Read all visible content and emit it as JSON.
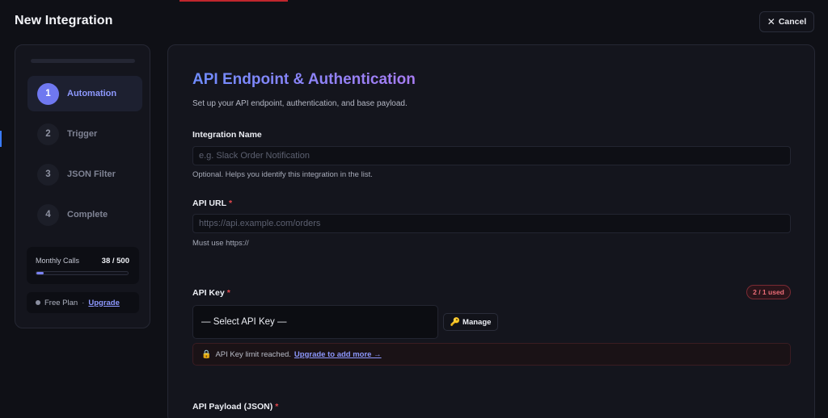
{
  "header": {
    "title": "New Integration",
    "cancel_label": "Cancel"
  },
  "steps": [
    {
      "number": "1",
      "label": "Automation",
      "active": true
    },
    {
      "number": "2",
      "label": "Trigger",
      "active": false
    },
    {
      "number": "3",
      "label": "JSON Filter",
      "active": false
    },
    {
      "number": "4",
      "label": "Complete",
      "active": false
    }
  ],
  "usage": {
    "label": "Monthly Calls",
    "count": "38 / 500",
    "progress_fraction": 0.076
  },
  "plan": {
    "name": "Free Plan",
    "separator": "·",
    "upgrade_label": "Upgrade"
  },
  "main": {
    "title": "API Endpoint & Authentication",
    "subtitle": "Set up your API endpoint, authentication, and base payload.",
    "integration_name": {
      "label": "Integration Name",
      "placeholder": "e.g. Slack Order Notification",
      "hint": "Optional. Helps you identify this integration in the list."
    },
    "api_url": {
      "label": "API URL",
      "required_mark": "*",
      "placeholder": "https://api.example.com/orders",
      "hint": "Must use https://"
    },
    "api_key": {
      "label": "API Key",
      "required_mark": "*",
      "badge": "2 / 1 used",
      "select_value": "— Select API Key —",
      "manage_label": "Manage",
      "alert_text": "API Key limit reached.",
      "alert_link": "Upgrade to add more →"
    },
    "api_payload": {
      "label": "API Payload (JSON)",
      "required_mark": "*"
    }
  },
  "colors": {
    "accent": "#6f78f0",
    "danger": "#e5484d",
    "link": "#8e99ff"
  },
  "icons": {
    "cancel": "close-icon",
    "manage": "key-icon",
    "alert": "lock-icon"
  }
}
